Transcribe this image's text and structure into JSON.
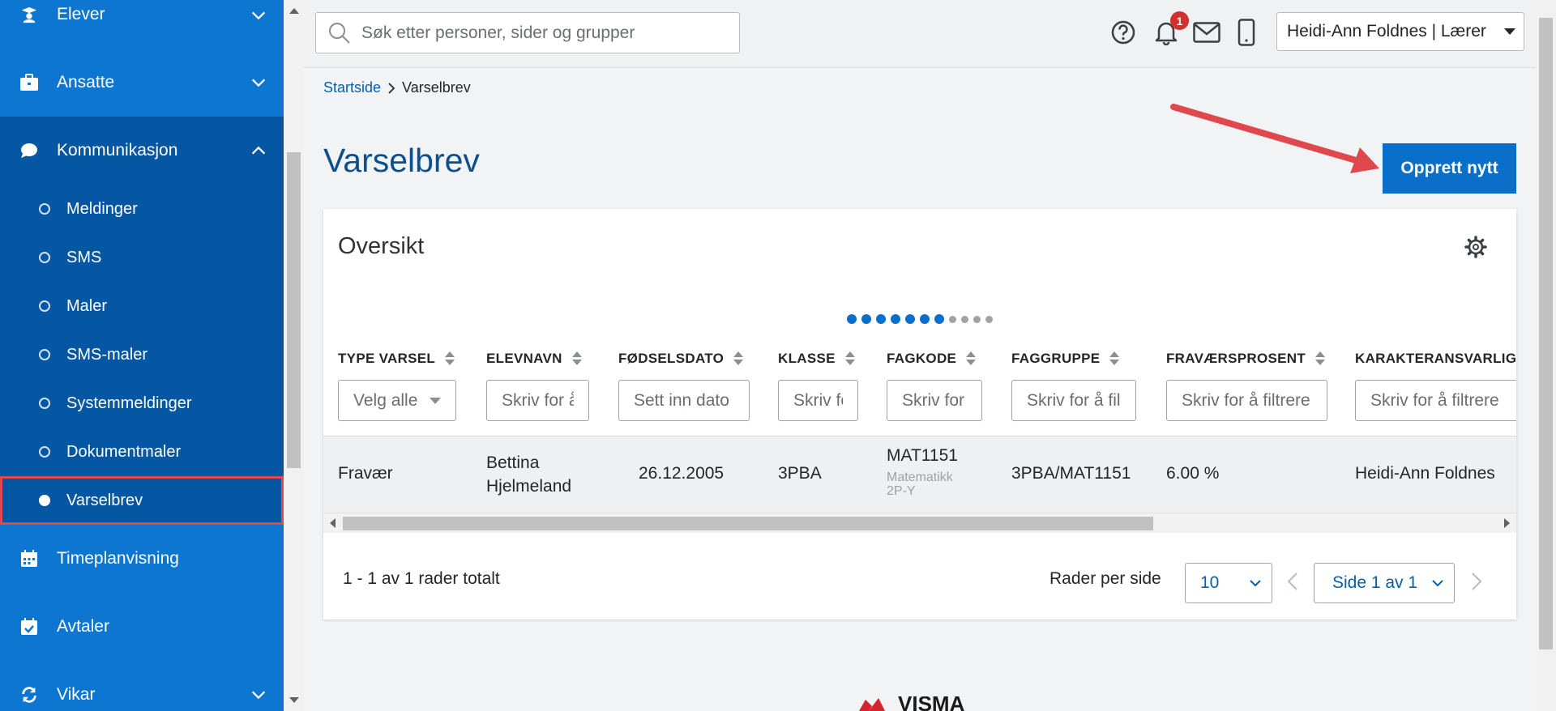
{
  "sidebar": {
    "items": [
      {
        "label": "Elever",
        "icon": "student-icon",
        "expanded": false
      },
      {
        "label": "Ansatte",
        "icon": "briefcase-icon",
        "expanded": false
      },
      {
        "label": "Kommunikasjon",
        "icon": "chat-icon",
        "expanded": true
      },
      {
        "label": "Timeplanvisning",
        "icon": "calendar-icon",
        "expanded": false
      },
      {
        "label": "Avtaler",
        "icon": "calendar-check-icon",
        "expanded": false
      },
      {
        "label": "Vikar",
        "icon": "refresh-icon",
        "expanded": false
      }
    ],
    "sub_items": [
      "Meldinger",
      "SMS",
      "Maler",
      "SMS-maler",
      "Systemmeldinger",
      "Dokumentmaler",
      "Varselbrev"
    ],
    "active_sub": "Varselbrev",
    "colors": {
      "background": "#0c76d1",
      "group": "#0557a3",
      "active_border": "#e0484f"
    }
  },
  "header": {
    "search_placeholder": "Søk etter personer, sider og grupper",
    "notification_count": "1",
    "user": "Heidi-Ann Foldnes | Lærer"
  },
  "breadcrumb": {
    "home": "Startside",
    "current": "Varselbrev"
  },
  "page": {
    "title": "Varselbrev",
    "create_button": "Opprett nytt"
  },
  "card": {
    "title": "Oversikt",
    "columns": [
      {
        "label": "TYPE VARSEL",
        "filter": "Velg alle",
        "filter_type": "select"
      },
      {
        "label": "ELEVNAVN",
        "filter": "Skriv for å filtrere"
      },
      {
        "label": "FØDSELSDATO",
        "filter": "Sett inn dato"
      },
      {
        "label": "KLASSE",
        "filter": "Skriv for å filtrere"
      },
      {
        "label": "FAGKODE",
        "filter": "Skriv for å filtrere"
      },
      {
        "label": "FAGGRUPPE",
        "filter": "Skriv for å filtrere"
      },
      {
        "label": "FRAVÆRSPROSENT",
        "filter": "Skriv for å filtrere"
      },
      {
        "label": "KARAKTERANSVARLIG L",
        "filter": "Skriv for å filtrere"
      }
    ],
    "rows": [
      {
        "type": "Fravær",
        "elevnavn_line1": "Bettina",
        "elevnavn_line2": "Hjelmeland",
        "fodselsdato": "26.12.2005",
        "klasse": "3PBA",
        "fagkode": "MAT1151",
        "fagkode_sub1": "Matematikk",
        "fagkode_sub2": "2P-Y",
        "faggruppe": "3PBA/MAT1151",
        "fravaersprosent": "6.00 %",
        "karakteransvarlig": "Heidi-Ann Foldnes"
      }
    ],
    "total_text": "1 - 1 av 1 rader totalt",
    "rows_per_page_label": "Rader per side",
    "rows_per_page": "10",
    "page_text": "Side 1 av 1"
  },
  "footer": {
    "logo_text": "VISMA"
  }
}
